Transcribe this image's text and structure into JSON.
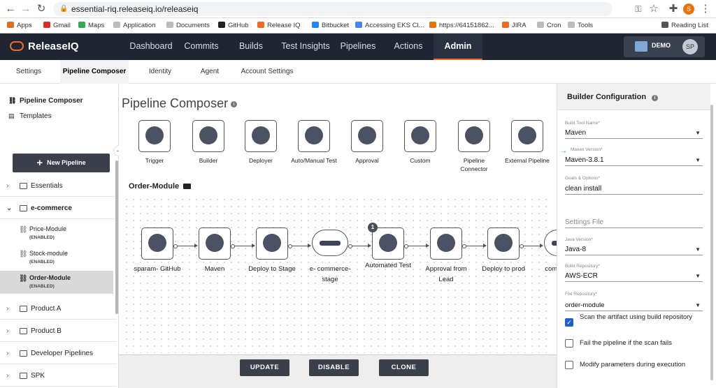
{
  "browser": {
    "url": "essential-riq.releaseiq.io/releaseiq",
    "profile_initial": "S",
    "reading_list": "Reading List",
    "bookmarks": [
      {
        "label": "Apps",
        "color": "#e0701f"
      },
      {
        "label": "Gmail",
        "color": "#d93025"
      },
      {
        "label": "Maps",
        "color": "#34a853"
      },
      {
        "label": "Application",
        "color": "#bbbbbb"
      },
      {
        "label": "Documents",
        "color": "#bbbbbb"
      },
      {
        "label": "GitHub",
        "color": "#222222"
      },
      {
        "label": "Release IQ",
        "color": "#f06a26"
      },
      {
        "label": "Bitbucket",
        "color": "#2684ff"
      },
      {
        "label": "Accessing EKS Cl...",
        "color": "#4285f4"
      },
      {
        "label": "https://64151862...",
        "color": "#e8710a"
      },
      {
        "label": "JIRA",
        "color": "#f06a26"
      },
      {
        "label": "Cron",
        "color": "#bbbbbb"
      },
      {
        "label": "Tools",
        "color": "#bbbbbb"
      }
    ]
  },
  "app": {
    "brand": "ReleaseIQ",
    "brand_color": "#f06a26",
    "nav": [
      "Dashboard",
      "Commits",
      "Builds",
      "Test Insights",
      "Pipelines",
      "Actions",
      "Admin"
    ],
    "active_nav": "Admin",
    "env_label": "DEMO",
    "user_initials": "SP"
  },
  "subnav": {
    "tabs": [
      "Settings",
      "Pipeline Composer",
      "Identity",
      "Agent",
      "Account Settings"
    ],
    "active": "Pipeline Composer"
  },
  "sidebar": {
    "top_items": [
      "Pipeline Composer",
      "Templates"
    ],
    "new_pipeline": "New Pipeline",
    "groups": [
      {
        "label": "Essentials",
        "expanded": false
      },
      {
        "label": "e-commerce",
        "expanded": true
      },
      {
        "label": "Product A",
        "expanded": false
      },
      {
        "label": "Product B",
        "expanded": false
      },
      {
        "label": "Developer Pipelines",
        "expanded": false
      },
      {
        "label": "SPK",
        "expanded": false
      }
    ],
    "modules": [
      {
        "name": "Price-Module",
        "status": "(ENABLED)"
      },
      {
        "name": "Stock-module",
        "status": "(ENABLED)"
      },
      {
        "name": "Order-Module",
        "status": "(ENABLED)",
        "selected": true
      }
    ]
  },
  "composer": {
    "title": "Pipeline Composer",
    "tools": [
      {
        "label": "Trigger",
        "icon": "lightning-icon"
      },
      {
        "label": "Builder",
        "icon": "gear-wrench-icon"
      },
      {
        "label": "Deployer",
        "icon": "rocket-icon"
      },
      {
        "label": "Auto/Manual Test",
        "icon": "flask-icon"
      },
      {
        "label": "Approval",
        "icon": "stamp-icon"
      },
      {
        "label": "Custom",
        "icon": "terminal-icon"
      },
      {
        "label": "Pipeline Connector",
        "icon": "connector-icon"
      },
      {
        "label": "External Pipeline",
        "icon": "valve-icon"
      }
    ],
    "pipeline_name": "Order-Module",
    "stages": [
      {
        "label": "sparam- GitHub",
        "icon": "lightning-icon"
      },
      {
        "label": "Maven",
        "icon": "gear-wrench-icon"
      },
      {
        "label": "Deploy to Stage",
        "icon": "rocket-icon"
      },
      {
        "label": "e- commerce- stage",
        "icon": "cloud-server-icon"
      },
      {
        "label": "Automated Test",
        "icon": "flask-icon",
        "badge": "1"
      },
      {
        "label": "Approval from Lead",
        "icon": "stamp-icon"
      },
      {
        "label": "Deploy to prod",
        "icon": "rocket-icon"
      },
      {
        "label": "comm... p...",
        "icon": "cloud-server-icon"
      }
    ],
    "actions": [
      "UPDATE",
      "DISABLE",
      "CLONE"
    ]
  },
  "builder": {
    "title": "Builder Configuration",
    "fields": {
      "build_tool": {
        "label": "Build Tool Name*",
        "value": "Maven"
      },
      "maven_version": {
        "label": "Maven Version*",
        "value": "Maven-3.8.1"
      },
      "goals": {
        "label": "Goals & Options*",
        "value": "clean install"
      },
      "settings_file": {
        "placeholder": "Settings File"
      },
      "java_version": {
        "label": "Java Version*",
        "value": "Java-8"
      },
      "build_repo": {
        "label": "Build Repository*",
        "value": "AWS-ECR"
      },
      "file_repo": {
        "label": "File Repository*",
        "value": "order-module"
      }
    },
    "checks": [
      {
        "label": "Scan the artifact using build repository",
        "checked": true
      },
      {
        "label": "Fail the pipeline if the scan fails",
        "checked": false
      },
      {
        "label": "Modify parameters during execution",
        "checked": false
      }
    ]
  }
}
